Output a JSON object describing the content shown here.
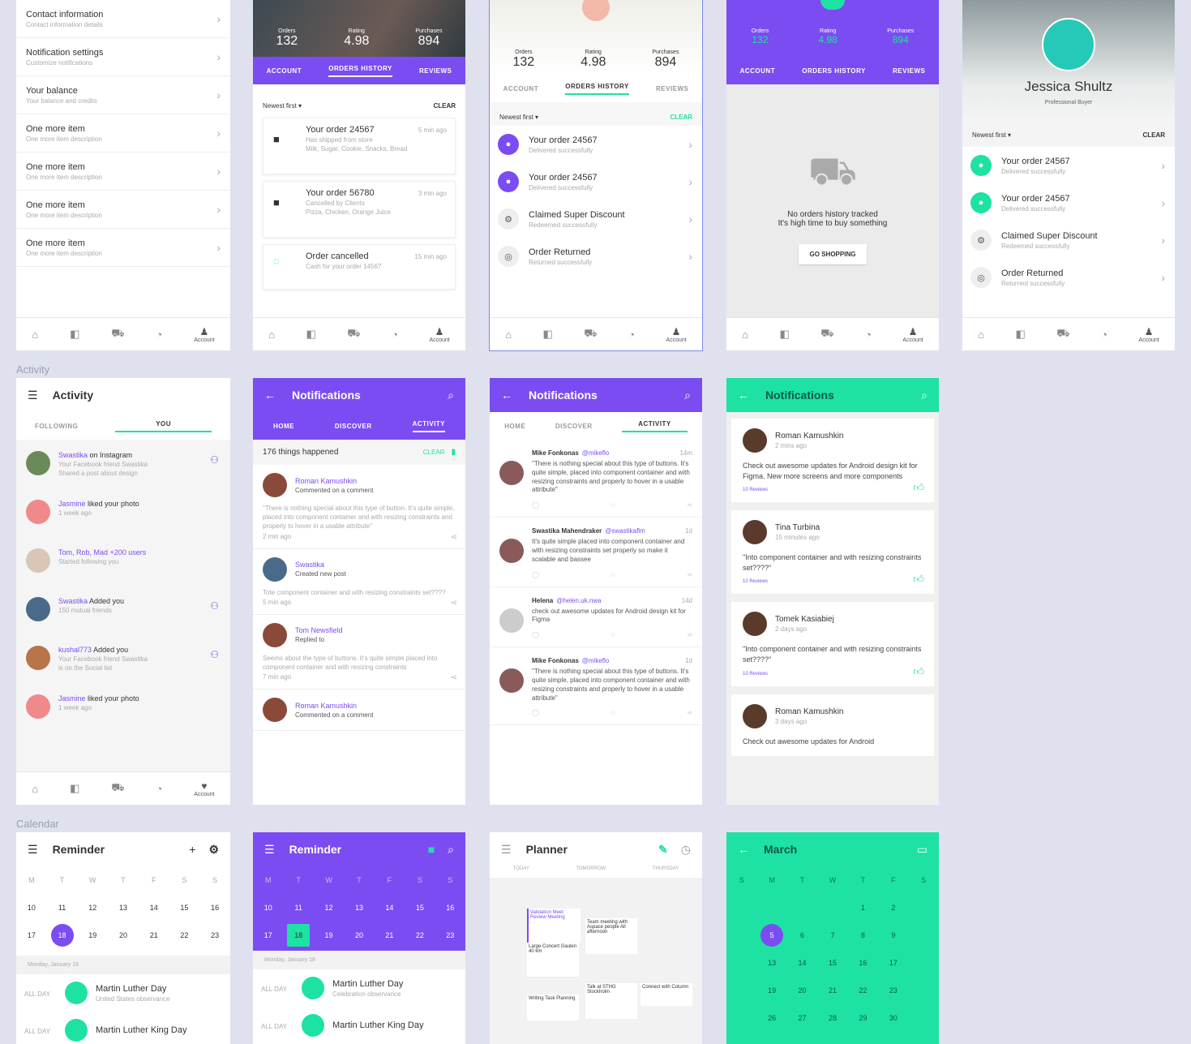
{
  "colors": {
    "accent_purple": "#7b4cf2",
    "accent_teal": "#1de2a4",
    "background": "#dfe2ee"
  },
  "section_labels": {
    "activity": "Activity",
    "calendar": "Calendar"
  },
  "settings": {
    "items": [
      {
        "title": "Contact information",
        "sub": "Contact information details"
      },
      {
        "title": "Notification settings",
        "sub": "Customize notifications"
      },
      {
        "title": "Your balance",
        "sub": "Your balance and credits"
      },
      {
        "title": "One more item",
        "sub": "One more item description"
      },
      {
        "title": "One more item",
        "sub": "One more item description"
      },
      {
        "title": "One more item",
        "sub": "One more item description"
      },
      {
        "title": "One more item",
        "sub": "One more item description"
      }
    ]
  },
  "bottom_nav": {
    "account_label": "Account",
    "icons": [
      "home-icon",
      "tag-icon",
      "cart-icon",
      "coupon-icon",
      "account-icon"
    ]
  },
  "profile_stats": {
    "labels": [
      "Orders",
      "Rating",
      "Purchases"
    ],
    "values": [
      "132",
      "4.98",
      "894"
    ]
  },
  "profile_tabs": [
    "ACCOUNT",
    "ORDERS HISTORY",
    "REVIEWS"
  ],
  "filter": {
    "newest_first": "Newest first",
    "clear": "CLEAR"
  },
  "orders_panel2": [
    {
      "title": "Your order 24567",
      "time": "5 min ago",
      "sub": "Has shipped from store",
      "detail": "Milk, Sugar, Cookie, Snacks, Bread"
    },
    {
      "title": "Your order 56780",
      "time": "3 min ago",
      "sub": "Cancelled by Clients",
      "detail": "Pizza, Chicken, Orange Juice"
    },
    {
      "title": "Order cancelled",
      "time": "15 min ago",
      "sub": "Cash for your order 14567"
    }
  ],
  "orders_panel3": [
    {
      "title": "Your order 24567",
      "sub": "Delivered successfully"
    },
    {
      "title": "Your order 24567",
      "sub": "Delivered successfully"
    },
    {
      "title": "Claimed Super Discount",
      "sub": "Redeemed successfully"
    },
    {
      "title": "Order Returned",
      "sub": "Returned successfully"
    }
  ],
  "empty_state": {
    "line1": "No orders history tracked",
    "line2": "It's high time to buy something",
    "button": "GO SHOPPING"
  },
  "profile5": {
    "name": "Jessica Shultz",
    "sub": "Professional Buyer"
  },
  "activity": {
    "title": "Activity",
    "tabs": [
      "FOLLOWING",
      "YOU"
    ],
    "items": [
      {
        "name": "Swastika",
        "action": "on Instagram",
        "sub": "Your Facebook friend Swastika",
        "sub2": "Shared a post about design"
      },
      {
        "name": "Jasmine",
        "action": "liked your photo",
        "sub": "1 week ago"
      },
      {
        "name": "Tom, Rob, Mad +200 users",
        "action": "",
        "sub": "Started following you"
      },
      {
        "name": "Swastika",
        "action": "Added you",
        "sub": "150 mutual friends"
      },
      {
        "name": "kushal773",
        "action": "Added you",
        "sub": "Your Facebook friend Swastika",
        "sub2": "is on the Social list"
      },
      {
        "name": "Jasmine",
        "action": "liked your photo",
        "sub": "1 week ago"
      }
    ]
  },
  "notif_purple": {
    "title": "Notifications",
    "tabs": [
      "HOME",
      "DISCOVER",
      "ACTIVITY"
    ],
    "count_text": "176 things happened",
    "clear": "CLEAR",
    "items": [
      {
        "name": "Roman Kamushkin",
        "action": "Commented on a comment",
        "quote": "\"There is nothing special about this type of button. It's quite simple, placed into component container and with resizing constraints and properly to hover in a usable attribute\"",
        "time": "2 min ago"
      },
      {
        "name": "Swastika",
        "action": "Created new post",
        "quote": "Tote component container and with resizing constraints set????",
        "time": "5 min ago"
      },
      {
        "name": "Tom Newsfield",
        "action": "Replied to",
        "quote": "Seems about the type of buttons. It's quite simple placed into component container and with resizing constraints",
        "time": "7 min ago"
      },
      {
        "name": "Roman Kamushkin",
        "action": "Commented on a comment",
        "quote": "",
        "time": ""
      }
    ]
  },
  "notif_white": {
    "title": "Notifications",
    "tabs": [
      "HOME",
      "DISCOVER",
      "ACTIVITY"
    ],
    "items": [
      {
        "name": "Mike Fonkonas",
        "handle": "@mikeflo",
        "time": "14m",
        "text": "\"There is nothing special about this type of buttons. It's quite simple, placed into component container and with resizing constraints and properly to hover in a usable attribute\""
      },
      {
        "name": "Swastika Mahendraker",
        "handle": "@swastikaflm",
        "time": "1d",
        "text": "It's quite simple placed into component container and with resizing constraints set properly so make it scalable and bassee"
      },
      {
        "name": "Helena",
        "handle": "@helen.uk.nwa",
        "time": "14d",
        "text": "check out awesome updates for Android design kit for Figma"
      },
      {
        "name": "Mike Fonkonas",
        "handle": "@mikeflo",
        "time": "1d",
        "text": "\"There is nothing special about this type of buttons. It's quite simple, placed into component container and with resizing constraints and properly to hover in a usable attribute\""
      }
    ]
  },
  "notif_teal": {
    "title": "Notifications",
    "items": [
      {
        "name": "Roman Kamushkin",
        "time": "2 mins ago",
        "text": "Check out awesome updates for Android design kit for Figma. New more screens and more components",
        "link": "10 Reviews"
      },
      {
        "name": "Tina Turbina",
        "time": "15 minutes ago",
        "text": "\"Into component container and with resizing constraints set????\"",
        "link": "10 Reviews"
      },
      {
        "name": "Tomek Kasiabiej",
        "time": "2 days ago",
        "text": "\"Into component container and with resizing constraints set????\"",
        "link": "10 Reviews"
      },
      {
        "name": "Roman Kamushkin",
        "time": "3 days ago",
        "text": "Check out awesome updates for Android",
        "link": ""
      }
    ]
  },
  "reminder_white": {
    "title": "Reminder",
    "weekdays": [
      "M",
      "T",
      "W",
      "T",
      "F",
      "S",
      "S"
    ],
    "week1": [
      "10",
      "11",
      "12",
      "13",
      "14",
      "15",
      "16"
    ],
    "week2": [
      "17",
      "18",
      "19",
      "20",
      "21",
      "22",
      "23"
    ],
    "selected": "18",
    "date_label": "Monday, January 18",
    "events": [
      {
        "time": "ALL DAY",
        "title": "Martin Luther Day",
        "sub": "United States observance"
      },
      {
        "time": "ALL DAY",
        "title": "Martin Luther King Day",
        "sub": ""
      }
    ]
  },
  "reminder_purple": {
    "title": "Reminder",
    "date_label": "Monday, January 18",
    "events": [
      {
        "time": "ALL DAY",
        "title": "Martin Luther Day",
        "sub": "Celebration observance"
      },
      {
        "time": "ALL DAY",
        "title": "Martin Luther King Day",
        "sub": ""
      }
    ]
  },
  "planner": {
    "title": "Planner",
    "cols": [
      "TODAY",
      "TOMORROW",
      "THURSDAY"
    ],
    "events": [
      "Validation Meet Review Meeting",
      "Team meeting with Aspace people All afternoon",
      "Large Concert Gaulen 40 km",
      "Talk at STHG Stockholm",
      "Connect with Column",
      "Writing Task Planning"
    ]
  },
  "march": {
    "title": "March",
    "weekdays": [
      "S",
      "M",
      "T",
      "W",
      "T",
      "F",
      "S"
    ],
    "rows": [
      [
        "",
        "",
        "",
        "",
        "1",
        "2",
        ""
      ],
      [
        "",
        "5",
        "6",
        "7",
        "8",
        "9",
        ""
      ],
      [
        "",
        "13",
        "14",
        "15",
        "16",
        "17",
        ""
      ],
      [
        "",
        "19",
        "20",
        "21",
        "22",
        "23",
        ""
      ],
      [
        "",
        "26",
        "27",
        "28",
        "29",
        "30",
        ""
      ]
    ],
    "selected": "5"
  }
}
